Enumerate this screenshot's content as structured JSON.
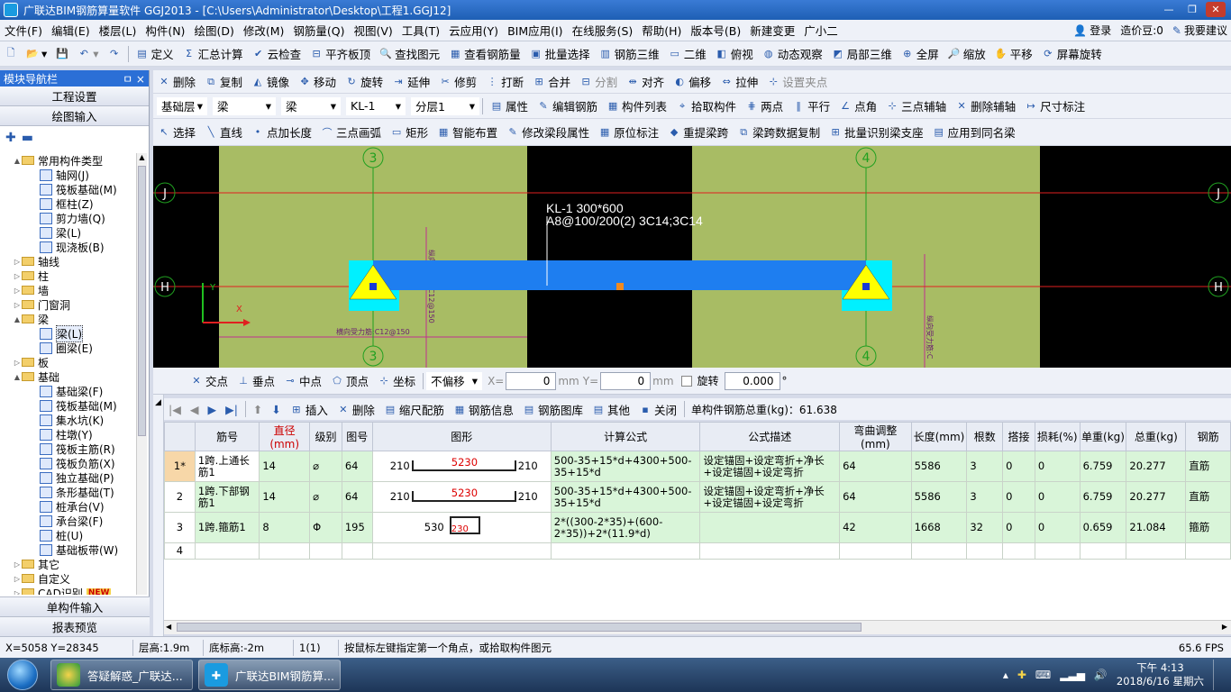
{
  "window": {
    "title": "广联达BIM钢筋算量软件 GGJ2013 - [C:\\Users\\Administrator\\Desktop\\工程1.GGJ12]"
  },
  "menu": {
    "items": [
      "文件(F)",
      "编辑(E)",
      "楼层(L)",
      "构件(N)",
      "绘图(D)",
      "修改(M)",
      "钢筋量(Q)",
      "视图(V)",
      "工具(T)",
      "云应用(Y)",
      "BIM应用(I)",
      "在线服务(S)",
      "帮助(H)",
      "版本号(B)",
      "新建变更",
      "广小二"
    ],
    "login": "登录",
    "beans": "造价豆:0",
    "suggest": "我要建议"
  },
  "toolbar1": {
    "items": [
      "定义",
      "汇总计算",
      "云检查",
      "平齐板顶",
      "查找图元",
      "查看钢筋量",
      "批量选择",
      "钢筋三维",
      "二维",
      "俯视",
      "动态观察",
      "局部三维",
      "全屏",
      "缩放",
      "平移",
      "屏幕旋转"
    ]
  },
  "toolbar2": {
    "items": [
      "删除",
      "复制",
      "镜像",
      "移动",
      "旋转",
      "延伸",
      "修剪",
      "打断",
      "合并",
      "分割",
      "对齐",
      "偏移",
      "拉伸",
      "设置夹点"
    ]
  },
  "toolbar3": {
    "floor": "基础层",
    "type1": "梁",
    "type2": "梁",
    "component": "KL-1",
    "layer": "分层1",
    "items": [
      "属性",
      "编辑钢筋",
      "构件列表",
      "拾取构件",
      "两点",
      "平行",
      "点角",
      "三点辅轴",
      "删除辅轴",
      "尺寸标注"
    ]
  },
  "toolbar4": {
    "items": [
      "选择",
      "直线",
      "点加长度",
      "三点画弧",
      "矩形",
      "智能布置",
      "修改梁段属性",
      "原位标注",
      "重提梁跨",
      "梁跨数据复制",
      "批量识别梁支座",
      "应用到同名梁"
    ]
  },
  "nav": {
    "title": "模块导航栏",
    "pin": "ㅁ ×",
    "btn_settings": "工程设置",
    "btn_draw": "绘图输入",
    "tree": [
      {
        "level": 0,
        "exp": "▲",
        "folder": true,
        "label": "常用构件类型"
      },
      {
        "level": 1,
        "label": "轴网(J)"
      },
      {
        "level": 1,
        "label": "筏板基础(M)"
      },
      {
        "level": 1,
        "label": "框柱(Z)"
      },
      {
        "level": 1,
        "label": "剪力墙(Q)"
      },
      {
        "level": 1,
        "label": "梁(L)"
      },
      {
        "level": 1,
        "label": "现浇板(B)"
      },
      {
        "level": 0,
        "exp": "▷",
        "folder": true,
        "label": "轴线"
      },
      {
        "level": 0,
        "exp": "▷",
        "folder": true,
        "label": "柱"
      },
      {
        "level": 0,
        "exp": "▷",
        "folder": true,
        "label": "墙"
      },
      {
        "level": 0,
        "exp": "▷",
        "folder": true,
        "label": "门窗洞"
      },
      {
        "level": 0,
        "exp": "▲",
        "folder": true,
        "label": "梁"
      },
      {
        "level": 1,
        "label": "梁(L)"
      },
      {
        "level": 1,
        "label": "圈梁(E)"
      },
      {
        "level": 0,
        "exp": "▷",
        "folder": true,
        "label": "板"
      },
      {
        "level": 0,
        "exp": "▲",
        "folder": true,
        "label": "基础"
      },
      {
        "level": 1,
        "label": "基础梁(F)"
      },
      {
        "level": 1,
        "label": "筏板基础(M)"
      },
      {
        "level": 1,
        "label": "集水坑(K)"
      },
      {
        "level": 1,
        "label": "柱墩(Y)"
      },
      {
        "level": 1,
        "label": "筏板主筋(R)"
      },
      {
        "level": 1,
        "label": "筏板负筋(X)"
      },
      {
        "level": 1,
        "label": "独立基础(P)"
      },
      {
        "level": 1,
        "label": "条形基础(T)"
      },
      {
        "level": 1,
        "label": "桩承台(V)"
      },
      {
        "level": 1,
        "label": "承台梁(F)"
      },
      {
        "level": 1,
        "label": "桩(U)"
      },
      {
        "level": 1,
        "label": "基础板带(W)"
      },
      {
        "level": 0,
        "exp": "▷",
        "folder": true,
        "label": "其它"
      },
      {
        "level": 0,
        "exp": "▷",
        "folder": true,
        "label": "自定义"
      },
      {
        "level": 0,
        "exp": "▷",
        "folder": true,
        "label": "CAD识别"
      }
    ],
    "new_badge": "NEW",
    "btn_single": "单构件输入",
    "btn_report": "报表预览"
  },
  "canvas": {
    "axis_3": "3",
    "axis_4": "4",
    "axis_J": "J",
    "axis_H": "H",
    "beam_label_1": "KL-1 300*600",
    "beam_label_2": "A8@100/200(2) 3C14;3C14",
    "slab_text_1": "横向受力筋:C12@150",
    "slab_text_2": "纵向受力筋:C12@150",
    "slab_text_3": "纵向受力筋:C",
    "ucs_x": "X",
    "ucs_y": "Y",
    "colors": {
      "slab": "#a8bc64",
      "beam": "#1e7ef0",
      "column": "#00f0ff",
      "support": "#ffff00",
      "axis": "#e02020",
      "grid": "#20a020"
    }
  },
  "snapbar": {
    "items": [
      "交点",
      "垂点",
      "中点",
      "顶点",
      "坐标"
    ],
    "offset": "不偏移",
    "x_label": "X=",
    "x_value": "0",
    "mm1": "mm",
    "y_label": "Y=",
    "y_value": "0",
    "mm2": "mm",
    "rotate_label": "旋转",
    "rotate_value": "0.000",
    "deg": "°"
  },
  "rebar_toolbar": {
    "items": [
      "插入",
      "删除",
      "缩尺配筋",
      "钢筋信息",
      "钢筋图库",
      "其他",
      "关闭"
    ],
    "total": "单构件钢筋总重(kg)：61.638"
  },
  "grid": {
    "headers": [
      "",
      "筋号",
      "直径(mm)",
      "级别",
      "图号",
      "图形",
      "计算公式",
      "公式描述",
      "弯曲调整(mm)",
      "长度(mm)",
      "根数",
      "搭接",
      "损耗(%)",
      "单重(kg)",
      "总重(kg)",
      "钢筋"
    ],
    "rows": [
      {
        "num": "1*",
        "name": "1跨.上通长筋1",
        "dia": "14",
        "grade": "⌀",
        "fig": "64",
        "shape_l": "210",
        "shape_m": "5230",
        "shape_r": "210",
        "formula": "500-35+15*d+4300+500-35+15*d",
        "desc": "设定锚固+设定弯折+净长+设定锚固+设定弯折",
        "bend": "64",
        "len": "5586",
        "count": "3",
        "lap": "0",
        "loss": "0",
        "unit_w": "6.759",
        "total_w": "20.277",
        "kind": "直筋"
      },
      {
        "num": "2",
        "name": "1跨.下部钢筋1",
        "dia": "14",
        "grade": "⌀",
        "fig": "64",
        "shape_l": "210",
        "shape_m": "5230",
        "shape_r": "210",
        "formula": "500-35+15*d+4300+500-35+15*d",
        "desc": "设定锚固+设定弯折+净长+设定锚固+设定弯折",
        "bend": "64",
        "len": "5586",
        "count": "3",
        "lap": "0",
        "loss": "0",
        "unit_w": "6.759",
        "total_w": "20.277",
        "kind": "直筋"
      },
      {
        "num": "3",
        "name": "1跨.箍筋1",
        "dia": "8",
        "grade": "Φ",
        "fig": "195",
        "shape_l": "530",
        "shape_m": "230",
        "shape_r": "",
        "formula": "2*((300-2*35)+(600-2*35))+2*(11.9*d)",
        "desc": "",
        "bend": "42",
        "len": "1668",
        "count": "32",
        "lap": "0",
        "loss": "0",
        "unit_w": "0.659",
        "total_w": "21.084",
        "kind": "箍筋"
      }
    ],
    "empty_row": "4"
  },
  "status": {
    "coords": "X=5058 Y=28345",
    "floor_height": "层高:1.9m",
    "bottom_height": "底标高:-2m",
    "count": "1(1)",
    "hint": "按鼠标左键指定第一个角点，或拾取构件图元",
    "fps": "65.6 FPS"
  },
  "taskbar": {
    "task1": "答疑解惑_广联达...",
    "task2": "广联达BIM钢筋算...",
    "time": "下午 4:13",
    "date": "2018/6/16 星期六"
  }
}
